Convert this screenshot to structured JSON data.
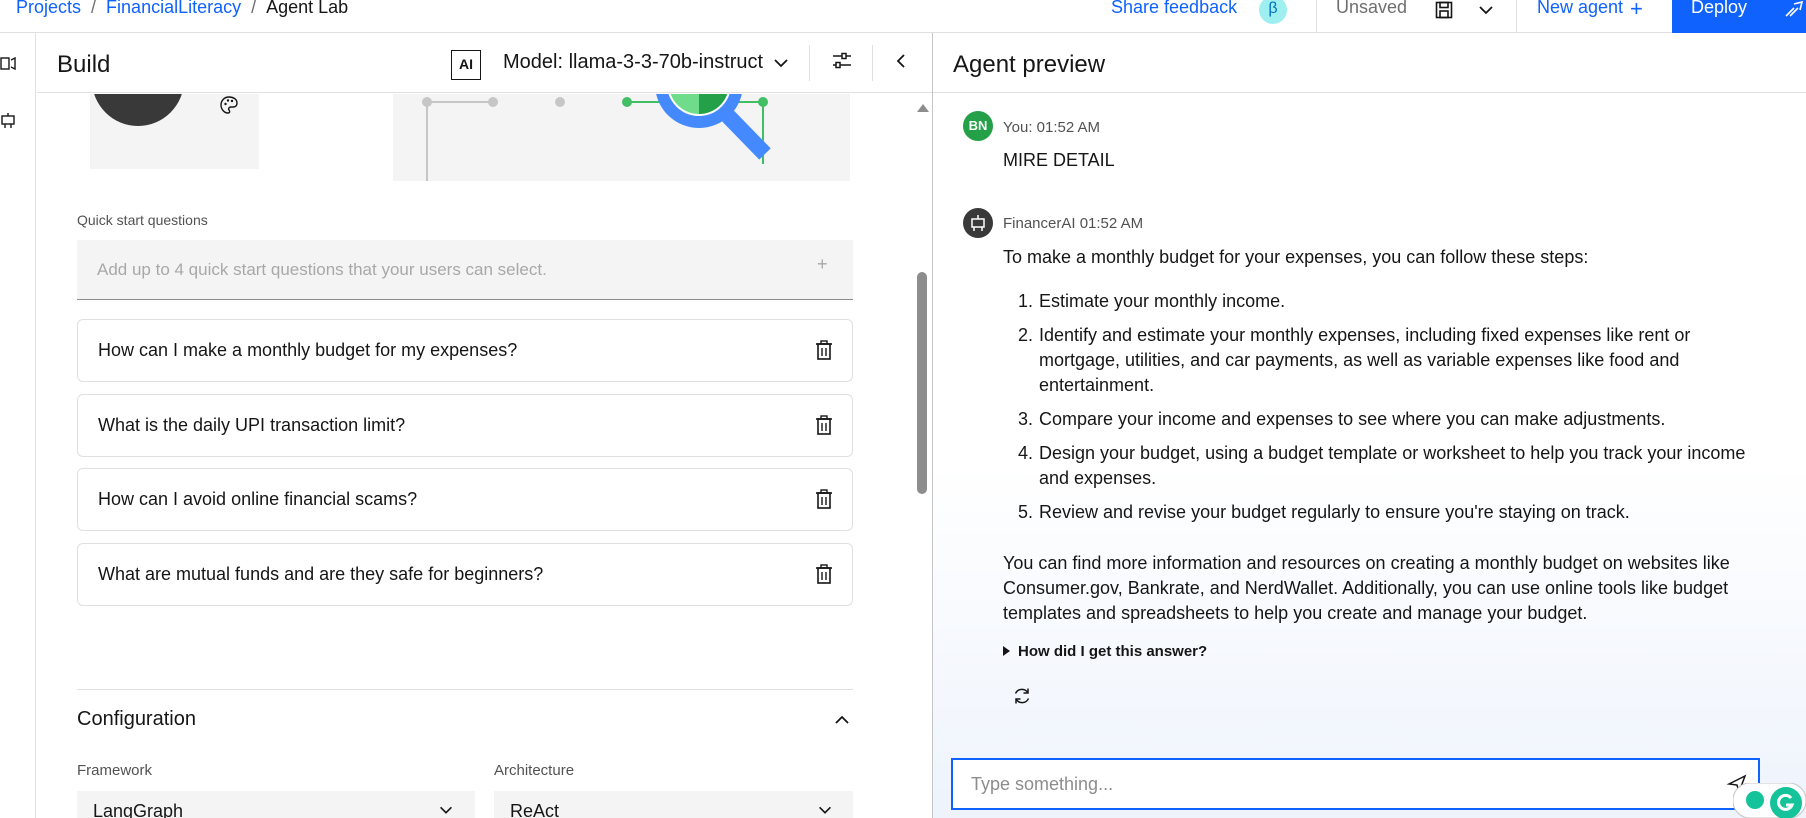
{
  "topbar": {
    "breadcrumb": [
      "Projects",
      "FinancialLiteracy",
      "Agent Lab"
    ],
    "separator": "/",
    "share_feedback": "Share feedback",
    "beta_badge": "β",
    "status": "Unsaved",
    "new_agent": "New agent",
    "new_agent_plus": "+",
    "deploy": "Deploy"
  },
  "build": {
    "title": "Build",
    "ai_badge": "AI",
    "model_label": "Model: llama-3-3-70b-instruct",
    "quick_start": {
      "label": "Quick start questions",
      "placeholder": "Add up to 4 quick start questions that your users can select.",
      "add_icon": "+",
      "questions": [
        "How can I make a monthly budget for my expenses?",
        "What is the daily UPI transaction limit?",
        "How can I avoid online financial scams?",
        "What are mutual funds and are they safe for beginners?"
      ]
    },
    "configuration": {
      "title": "Configuration",
      "framework_label": "Framework",
      "framework_value": "LangGraph",
      "architecture_label": "Architecture",
      "architecture_value": "ReAct"
    }
  },
  "preview": {
    "title": "Agent preview",
    "user_message": {
      "avatar": "BN",
      "meta": "You: 01:52 AM",
      "text": "MIRE DETAIL"
    },
    "agent_message": {
      "meta": "FinancerAI 01:52 AM",
      "intro": "To make a monthly budget for your expenses, you can follow these steps:",
      "steps": [
        "Estimate your monthly income.",
        "Identify and estimate your monthly expenses, including fixed expenses like rent or mortgage, utilities, and car payments, as well as variable expenses like food and entertainment.",
        "Compare your income and expenses to see where you can make adjustments.",
        "Design your budget, using a budget template or worksheet to help you track your income and expenses.",
        "Review and revise your budget regularly to ensure you're staying on track."
      ],
      "closing": "You can find more information and resources on creating a monthly budget on websites like Consumer.gov, Bankrate, and NerdWallet. Additionally, you can use online tools like budget templates and spreadsheets to help you create and manage your budget.",
      "how_link": "How did I get this answer?"
    },
    "input_placeholder": "Type something..."
  },
  "icons": {
    "save": "save-icon",
    "chevron": "chevron-down-icon",
    "settings": "sliders-icon",
    "collapse": "chevron-left-icon",
    "trash": "trash-icon",
    "regenerate": "refresh-icon",
    "palette": "palette-icon"
  },
  "colors": {
    "accent": "#0f62fe",
    "user_avatar": "#24a148",
    "agent_avatar": "#393939",
    "beta_bg": "#9ef0f0"
  }
}
